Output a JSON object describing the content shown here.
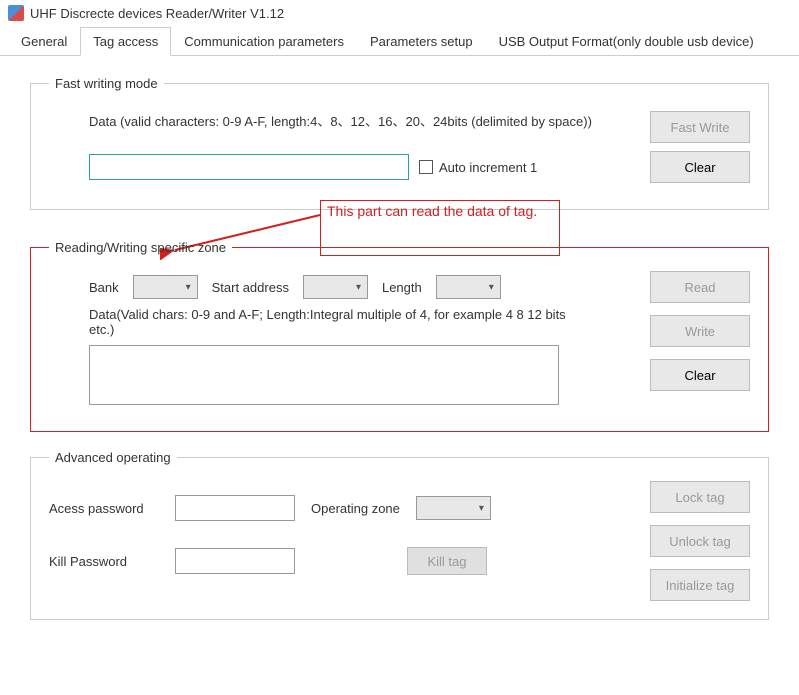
{
  "window": {
    "title": "UHF Discrecte devices Reader/Writer V1.12"
  },
  "tabs": {
    "general": "General",
    "tag_access": "Tag access",
    "communication": "Communication parameters",
    "parameters": "Parameters setup",
    "usb_output": "USB Output Format(only double usb device)"
  },
  "fast_writing": {
    "legend": "Fast writing mode",
    "data_label": "Data (valid characters: 0-9 A-F, length:4、8、12、16、20、24bits (delimited by space))",
    "input_value": "",
    "auto_increment_label": "Auto increment 1",
    "fast_write_btn": "Fast Write",
    "clear_btn": "Clear"
  },
  "annotation": {
    "text": "This part can read the data of tag."
  },
  "rw_zone": {
    "legend": "Reading/Writing specific zone",
    "bank_label": "Bank",
    "start_label": "Start address",
    "length_label": "Length",
    "data_hint": "Data(Valid chars: 0-9 and A-F; Length:Integral multiple of 4, for example 4 8 12 bits etc.)",
    "read_btn": "Read",
    "write_btn": "Write",
    "clear_btn": "Clear"
  },
  "advanced": {
    "legend": "Advanced operating",
    "access_pw_label": "Acess password",
    "operating_zone_label": "Operating zone",
    "kill_pw_label": "Kill Password",
    "kill_btn": "Kill tag",
    "lock_btn": "Lock tag",
    "unlock_btn": "Unlock tag",
    "initialize_btn": "Initialize tag"
  }
}
